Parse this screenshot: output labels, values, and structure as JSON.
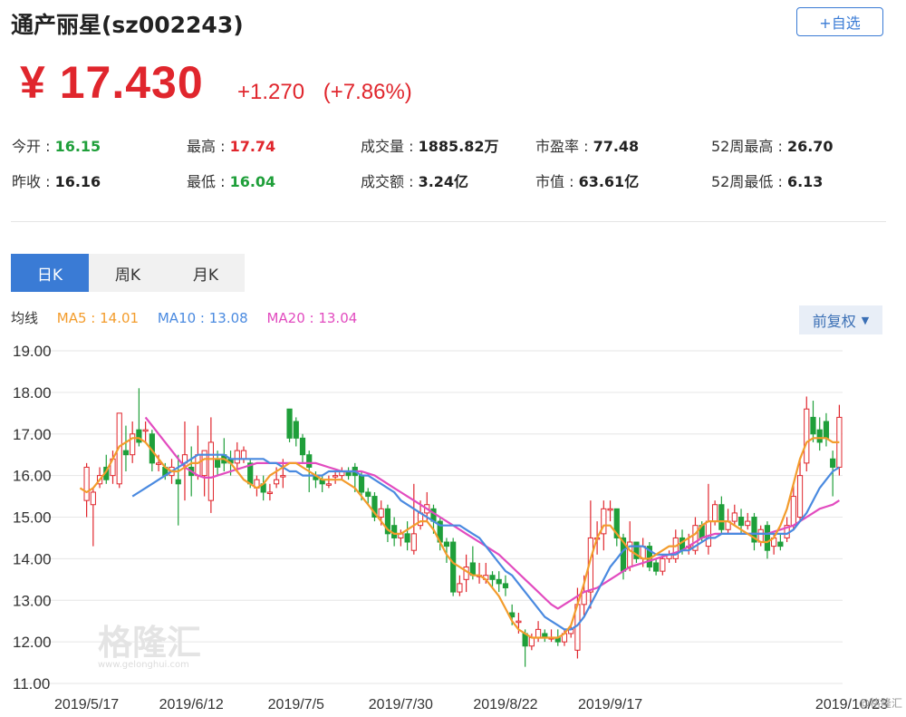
{
  "header": {
    "title": "通产丽星(sz002243)",
    "add_button": "+自选"
  },
  "quote": {
    "price": "¥ 17.430",
    "change": "+1.270",
    "change_pct": "(+7.86%)"
  },
  "stats": [
    {
      "label": "今开 : ",
      "value": "16.15",
      "color": "green"
    },
    {
      "label": "最高 : ",
      "value": "17.74",
      "color": "red"
    },
    {
      "label": "成交量 : ",
      "value": "1885.82万",
      "color": "dark"
    },
    {
      "label": "市盈率 : ",
      "value": "77.48",
      "color": "dark"
    },
    {
      "label": "52周最高 : ",
      "value": "26.70",
      "color": "dark"
    },
    {
      "label": "昨收 : ",
      "value": "16.16",
      "color": "dark"
    },
    {
      "label": "最低 : ",
      "value": "16.04",
      "color": "green"
    },
    {
      "label": "成交额 : ",
      "value": "3.24亿",
      "color": "dark"
    },
    {
      "label": "市值 : ",
      "value": "63.61亿",
      "color": "dark"
    },
    {
      "label": "52周最低 : ",
      "value": "6.13",
      "color": "dark"
    }
  ],
  "tabs": [
    "日K",
    "周K",
    "月K"
  ],
  "ma": {
    "label": "均线",
    "ma5": "MA5 : 14.01",
    "ma10": "MA10 : 13.08",
    "ma20": "MA20 : 13.04"
  },
  "adjust_button": "前复权",
  "watermark": {
    "cn": "格隆汇",
    "en": "www.gelonghui.com"
  },
  "corner_mark": "@格隆汇",
  "colors": {
    "up": "#e0262d",
    "down": "#1f9f3a",
    "ma5": "#f39c2c",
    "ma10": "#4a8ae0",
    "ma20": "#e24bbf",
    "accent": "#3a7bd5",
    "grid": "#e6e6e6"
  },
  "chart_data": {
    "type": "candlestick",
    "y_ticks": [
      "19.00",
      "18.00",
      "17.00",
      "16.00",
      "15.00",
      "14.00",
      "13.00",
      "12.00",
      "11.00"
    ],
    "ylim": [
      11,
      19
    ],
    "x_labels": [
      "2019/5/17",
      "2019/6/12",
      "2019/7/5",
      "2019/7/30",
      "2019/8/22",
      "2019/9/17",
      "2019/10/23"
    ],
    "x_label_index": [
      0,
      16,
      32,
      48,
      64,
      80,
      103
    ],
    "candles": [
      [
        15.4,
        16.2,
        15.0,
        16.3
      ],
      [
        15.3,
        15.6,
        14.3,
        15.7
      ],
      [
        15.8,
        16.0,
        15.7,
        16.2
      ],
      [
        16.2,
        15.9,
        15.8,
        16.5
      ],
      [
        16.0,
        16.4,
        15.8,
        16.6
      ],
      [
        15.8,
        17.5,
        15.7,
        17.5
      ],
      [
        16.6,
        16.5,
        16.1,
        17.2
      ],
      [
        16.5,
        17.0,
        16.3,
        17.3
      ],
      [
        17.1,
        16.8,
        16.7,
        18.1
      ],
      [
        17.1,
        17.1,
        16.8,
        17.3
      ],
      [
        17.0,
        16.3,
        16.1,
        17.1
      ],
      [
        16.3,
        16.3,
        16.1,
        16.5
      ],
      [
        16.2,
        16.0,
        15.9,
        16.3
      ],
      [
        16.0,
        16.2,
        15.8,
        16.4
      ],
      [
        15.9,
        15.8,
        14.8,
        16.5
      ],
      [
        16.3,
        16.5,
        15.4,
        17.3
      ],
      [
        16.2,
        16.0,
        15.5,
        16.7
      ],
      [
        16.0,
        16.5,
        15.9,
        17.2
      ],
      [
        16.0,
        16.6,
        15.5,
        16.6
      ],
      [
        15.4,
        16.8,
        15.1,
        17.4
      ],
      [
        16.4,
        16.2,
        16.0,
        16.6
      ],
      [
        16.5,
        16.3,
        16.1,
        16.9
      ],
      [
        16.4,
        16.3,
        16.0,
        16.6
      ],
      [
        16.3,
        16.6,
        16.1,
        16.8
      ],
      [
        16.4,
        16.6,
        16.3,
        16.7
      ],
      [
        16.3,
        15.8,
        15.7,
        16.4
      ],
      [
        15.7,
        15.9,
        15.5,
        16.0
      ],
      [
        15.8,
        15.6,
        15.4,
        16.0
      ],
      [
        15.6,
        15.6,
        15.4,
        15.8
      ],
      [
        15.8,
        15.9,
        15.7,
        16.2
      ],
      [
        16.0,
        16.0,
        15.7,
        16.4
      ],
      [
        17.6,
        16.9,
        16.8,
        17.5
      ],
      [
        17.3,
        16.9,
        16.7,
        17.4
      ],
      [
        16.9,
        16.5,
        16.3,
        17.0
      ],
      [
        16.5,
        16.2,
        15.6,
        16.6
      ],
      [
        16.0,
        15.9,
        15.7,
        16.1
      ],
      [
        15.9,
        15.8,
        15.6,
        16.0
      ],
      [
        15.8,
        15.8,
        15.7,
        16.0
      ],
      [
        16.0,
        16.0,
        15.8,
        16.1
      ],
      [
        16.0,
        16.1,
        15.9,
        16.2
      ],
      [
        16.1,
        16.0,
        15.9,
        16.2
      ],
      [
        16.2,
        16.0,
        15.6,
        16.3
      ],
      [
        16.0,
        15.6,
        15.4,
        16.1
      ],
      [
        15.6,
        15.5,
        15.3,
        15.7
      ],
      [
        15.5,
        15.0,
        14.9,
        15.6
      ],
      [
        15.0,
        15.2,
        14.8,
        15.4
      ],
      [
        15.2,
        14.6,
        14.4,
        15.3
      ],
      [
        14.8,
        14.5,
        14.3,
        15.0
      ],
      [
        14.5,
        14.6,
        14.3,
        14.7
      ],
      [
        14.6,
        14.4,
        14.2,
        14.9
      ],
      [
        14.2,
        14.6,
        14.1,
        15.8
      ],
      [
        14.8,
        15.1,
        14.7,
        15.4
      ],
      [
        15.1,
        15.3,
        14.9,
        15.6
      ],
      [
        15.2,
        14.9,
        14.6,
        15.3
      ],
      [
        14.9,
        14.4,
        14.2,
        15.0
      ],
      [
        14.4,
        14.3,
        13.9,
        14.5
      ],
      [
        14.4,
        13.2,
        13.1,
        14.5
      ],
      [
        13.2,
        13.4,
        13.1,
        13.6
      ],
      [
        13.5,
        13.8,
        13.2,
        14.1
      ],
      [
        13.9,
        13.6,
        13.5,
        14.3
      ],
      [
        13.6,
        13.6,
        13.4,
        13.9
      ],
      [
        13.5,
        13.6,
        13.4,
        13.9
      ],
      [
        13.6,
        13.5,
        13.3,
        13.7
      ],
      [
        13.5,
        13.4,
        13.2,
        13.7
      ],
      [
        13.4,
        13.3,
        13.1,
        13.6
      ],
      [
        12.7,
        12.6,
        12.4,
        12.9
      ],
      [
        12.5,
        12.5,
        12.2,
        12.7
      ],
      [
        12.2,
        11.9,
        11.4,
        12.3
      ],
      [
        11.9,
        12.1,
        11.8,
        12.2
      ],
      [
        12.1,
        12.3,
        12.0,
        12.5
      ],
      [
        12.2,
        12.1,
        12.0,
        12.3
      ],
      [
        12.1,
        12.1,
        12.0,
        12.3
      ],
      [
        12.1,
        12.0,
        11.9,
        12.3
      ],
      [
        12.0,
        12.2,
        11.9,
        12.3
      ],
      [
        12.2,
        12.3,
        12.1,
        12.4
      ],
      [
        11.8,
        12.9,
        11.6,
        13.3
      ],
      [
        12.9,
        13.2,
        12.6,
        13.6
      ],
      [
        13.2,
        14.5,
        12.8,
        15.4
      ],
      [
        14.5,
        14.5,
        14.1,
        14.9
      ],
      [
        14.6,
        15.2,
        14.2,
        15.4
      ],
      [
        15.2,
        15.2,
        14.9,
        15.4
      ],
      [
        15.2,
        14.5,
        14.3,
        15.2
      ],
      [
        14.5,
        13.7,
        13.5,
        14.6
      ],
      [
        13.8,
        14.4,
        13.7,
        14.9
      ],
      [
        14.4,
        14.0,
        13.9,
        14.4
      ],
      [
        14.0,
        14.3,
        13.8,
        14.5
      ],
      [
        14.3,
        13.8,
        13.7,
        14.4
      ],
      [
        13.9,
        13.7,
        13.6,
        14.0
      ],
      [
        13.7,
        14.0,
        13.6,
        14.1
      ],
      [
        14.0,
        14.1,
        13.9,
        14.2
      ],
      [
        14.0,
        14.5,
        13.9,
        14.7
      ],
      [
        14.5,
        14.2,
        14.1,
        14.7
      ],
      [
        14.3,
        14.3,
        14.1,
        14.6
      ],
      [
        14.2,
        14.8,
        14.1,
        15.0
      ],
      [
        14.8,
        14.5,
        14.4,
        14.9
      ],
      [
        14.3,
        14.9,
        14.1,
        15.8
      ],
      [
        14.9,
        15.3,
        14.8,
        15.4
      ],
      [
        15.3,
        14.7,
        14.6,
        15.5
      ],
      [
        14.7,
        14.9,
        14.6,
        15.2
      ],
      [
        14.9,
        15.1,
        14.8,
        15.3
      ],
      [
        15.0,
        14.8,
        14.6,
        15.2
      ],
      [
        14.8,
        14.9,
        14.7,
        15.1
      ],
      [
        15.0,
        14.4,
        14.2,
        15.1
      ],
      [
        14.4,
        14.7,
        14.3,
        14.8
      ],
      [
        14.8,
        14.2,
        14.0,
        14.9
      ],
      [
        14.3,
        14.5,
        14.1,
        14.6
      ],
      [
        14.4,
        14.3,
        14.2,
        14.6
      ],
      [
        14.5,
        14.8,
        14.4,
        15.0
      ],
      [
        14.8,
        15.5,
        14.7,
        15.8
      ],
      [
        15.0,
        16.0,
        14.9,
        16.4
      ],
      [
        16.3,
        17.6,
        16.1,
        17.9
      ],
      [
        17.4,
        17.0,
        16.8,
        17.8
      ],
      [
        17.1,
        16.8,
        16.6,
        17.4
      ],
      [
        17.3,
        16.9,
        16.7,
        17.5
      ],
      [
        16.4,
        16.2,
        15.5,
        16.6
      ],
      [
        16.2,
        17.4,
        16.0,
        17.7
      ]
    ],
    "ma5": [
      15.7,
      15.6,
      15.7,
      15.9,
      16.1,
      16.4,
      16.7,
      16.8,
      16.9,
      16.9,
      16.8,
      16.6,
      16.4,
      16.2,
      16.1,
      16.1,
      16.2,
      16.3,
      16.3,
      16.4,
      16.4,
      16.4,
      16.4,
      16.3,
      16.1,
      15.9,
      15.8,
      15.7,
      15.8,
      16.0,
      16.1,
      16.2,
      16.3,
      16.3,
      16.2,
      16.1,
      16.0,
      15.9,
      15.9,
      15.9,
      15.9,
      15.8,
      15.7,
      15.5,
      15.3,
      15.1,
      14.9,
      14.7,
      14.6,
      14.6,
      14.7,
      14.8,
      14.9,
      14.9,
      14.7,
      14.4,
      14.1,
      13.9,
      13.8,
      13.7,
      13.6,
      13.6,
      13.5,
      13.3,
      13.1,
      12.8,
      12.5,
      12.3,
      12.2,
      12.1,
      12.1,
      12.1,
      12.1,
      12.1,
      12.2,
      12.4,
      12.9,
      13.4,
      14.0,
      14.5,
      14.8,
      14.8,
      14.6,
      14.4,
      14.2,
      14.1,
      14.0,
      14.0,
      14.1,
      14.2,
      14.3,
      14.3,
      14.4,
      14.5,
      14.6,
      14.8,
      14.9,
      14.9,
      14.9,
      14.9,
      14.8,
      14.7,
      14.6,
      14.5,
      14.4,
      14.4,
      14.5,
      14.8,
      15.2,
      15.8,
      16.4,
      16.8,
      16.9,
      16.9,
      16.9,
      16.8,
      16.8
    ],
    "ma10": [
      15.5,
      15.6,
      15.7,
      15.8,
      15.9,
      16.0,
      16.1,
      16.2,
      16.3,
      16.4,
      16.5,
      16.5,
      16.5,
      16.5,
      16.5,
      16.4,
      16.4,
      16.4,
      16.4,
      16.4,
      16.4,
      16.3,
      16.3,
      16.2,
      16.1,
      16.1,
      16.0,
      16.0,
      16.0,
      16.0,
      16.1,
      16.1,
      16.1,
      16.1,
      16.1,
      16.0,
      16.0,
      15.9,
      15.8,
      15.7,
      15.6,
      15.4,
      15.3,
      15.2,
      15.1,
      15.0,
      14.9,
      14.8,
      14.8,
      14.8,
      14.8,
      14.7,
      14.6,
      14.5,
      14.3,
      14.1,
      13.9,
      13.7,
      13.6,
      13.4,
      13.2,
      13.0,
      12.8,
      12.6,
      12.5,
      12.4,
      12.3,
      12.3,
      12.4,
      12.6,
      12.9,
      13.2,
      13.5,
      13.8,
      14.0,
      14.2,
      14.3,
      14.3,
      14.3,
      14.2,
      14.1,
      14.1,
      14.1,
      14.1,
      14.2,
      14.2,
      14.3,
      14.4,
      14.5,
      14.5,
      14.6,
      14.6,
      14.6,
      14.6,
      14.6,
      14.6,
      14.6,
      14.6,
      14.6,
      14.6,
      14.6,
      14.7,
      14.9,
      15.1,
      15.4,
      15.7,
      15.9,
      16.1,
      16.2
    ],
    "ma20": [
      17.4,
      17.2,
      17.0,
      16.8,
      16.6,
      16.4,
      16.2,
      16.1,
      16.0,
      15.95,
      15.95,
      16.0,
      16.05,
      16.1,
      16.15,
      16.2,
      16.25,
      16.3,
      16.3,
      16.3,
      16.3,
      16.3,
      16.3,
      16.3,
      16.3,
      16.3,
      16.3,
      16.25,
      16.2,
      16.15,
      16.1,
      16.1,
      16.1,
      16.1,
      16.05,
      16.0,
      15.9,
      15.8,
      15.7,
      15.6,
      15.5,
      15.4,
      15.3,
      15.2,
      15.1,
      15.0,
      14.9,
      14.8,
      14.7,
      14.6,
      14.5,
      14.4,
      14.3,
      14.2,
      14.1,
      13.95,
      13.8,
      13.65,
      13.5,
      13.35,
      13.2,
      13.05,
      12.9,
      12.8,
      12.9,
      13.0,
      13.1,
      13.2,
      13.25,
      13.3,
      13.4,
      13.5,
      13.6,
      13.7,
      13.8,
      13.85,
      13.9,
      13.95,
      14.0,
      14.05,
      14.1,
      14.15,
      14.2,
      14.3,
      14.4,
      14.5,
      14.55,
      14.6,
      14.6,
      14.6,
      14.6,
      14.6,
      14.6,
      14.6,
      14.6,
      14.6,
      14.65,
      14.7,
      14.75,
      14.8,
      14.9,
      15.0,
      15.1,
      15.2,
      15.25,
      15.3,
      15.4
    ]
  }
}
